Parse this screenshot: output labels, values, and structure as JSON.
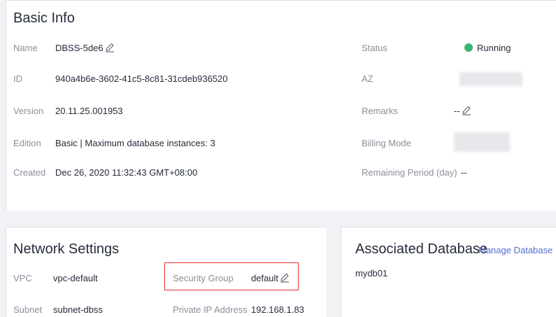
{
  "basic_info": {
    "title": "Basic Info",
    "name_label": "Name",
    "name_value": "DBSS-5de6",
    "id_label": "ID",
    "id_value": "940a4b6e-3602-41c5-8c81-31cdeb936520",
    "version_label": "Version",
    "version_value": "20.11.25.001953",
    "edition_label": "Edition",
    "edition_value": "Basic | Maximum database instances: 3",
    "created_label": "Created",
    "created_value": "Dec 26, 2020 11:32:43 GMT+08:00",
    "status_label": "Status",
    "status_value": "Running",
    "az_label": "AZ",
    "remarks_label": "Remarks",
    "remarks_value": "--",
    "billing_label": "Billing Mode",
    "remaining_label": "Remaining Period (day)",
    "remaining_value": "--"
  },
  "network_settings": {
    "title": "Network Settings",
    "vpc_label": "VPC",
    "vpc_value": "vpc-default",
    "security_group_label": "Security Group",
    "security_group_value": "default",
    "subnet_label": "Subnet",
    "subnet_value": "subnet-dbss",
    "private_ip_label": "Private IP Address",
    "private_ip_value": "192.168.1.83"
  },
  "associated_database": {
    "title": "Associated Database",
    "manage_link": "Manage Database",
    "databases": [
      "mydb01"
    ]
  },
  "colors": {
    "status_running": "#3cb371",
    "link": "#526ecc",
    "highlight_border": "#e5322d"
  }
}
